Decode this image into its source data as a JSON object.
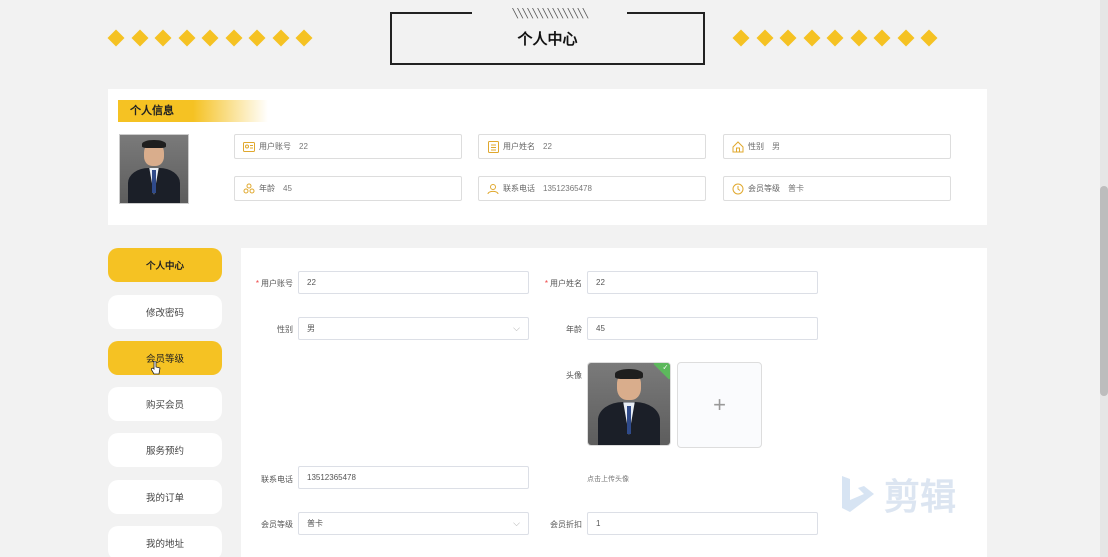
{
  "header": {
    "title": "个人中心",
    "hatch": "╲╲╲╲╲╲╲╲╲╲╲╲╲╲╲"
  },
  "info": {
    "tag": "个人信息",
    "fields": [
      {
        "label": "用户账号",
        "value": "22",
        "icon": "id-card-icon"
      },
      {
        "label": "用户姓名",
        "value": "22",
        "icon": "list-icon"
      },
      {
        "label": "性别",
        "value": "男",
        "icon": "home-icon"
      },
      {
        "label": "年龄",
        "value": "45",
        "icon": "people-icon"
      },
      {
        "label": "联系电话",
        "value": "13512365478",
        "icon": "user-icon"
      },
      {
        "label": "会员等级",
        "value": "普卡",
        "icon": "clock-icon"
      }
    ]
  },
  "sidebar": {
    "items": [
      {
        "label": "个人中心",
        "active": true
      },
      {
        "label": "修改密码",
        "active": false
      },
      {
        "label": "会员等级",
        "active": true
      },
      {
        "label": "购买会员",
        "active": false
      },
      {
        "label": "服务预约",
        "active": false
      },
      {
        "label": "我的订单",
        "active": false
      },
      {
        "label": "我的地址",
        "active": false
      }
    ]
  },
  "form": {
    "account_label": "用户账号",
    "account_value": "22",
    "name_label": "用户姓名",
    "name_value": "22",
    "gender_label": "性别",
    "gender_value": "男",
    "age_label": "年龄",
    "age_value": "45",
    "avatar_label": "头像",
    "upload_tip": "点击上传头像",
    "phone_label": "联系电话",
    "phone_value": "13512365478",
    "level_label": "会员等级",
    "level_value": "普卡",
    "discount_label": "会员折扣",
    "discount_value": "1",
    "add_symbol": "+"
  },
  "watermark": {
    "text": "剪辑"
  },
  "colors": {
    "accent": "#f5c223",
    "background": "#f2f2f2"
  }
}
